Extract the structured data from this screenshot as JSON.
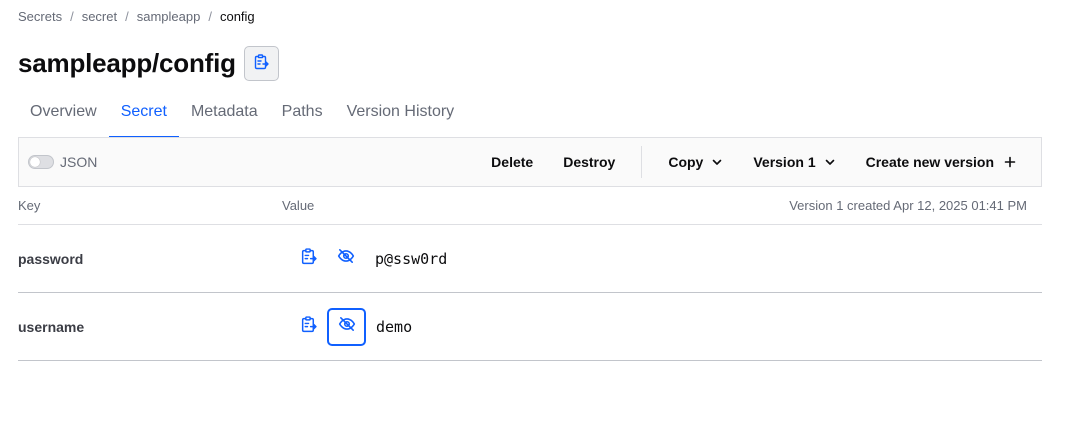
{
  "breadcrumb": {
    "items": [
      "Secrets",
      "secret",
      "sampleapp"
    ],
    "current": "config",
    "separator": "/"
  },
  "page": {
    "title": "sampleapp/config"
  },
  "tabs": [
    {
      "label": "Overview",
      "active": false
    },
    {
      "label": "Secret",
      "active": true
    },
    {
      "label": "Metadata",
      "active": false
    },
    {
      "label": "Paths",
      "active": false
    },
    {
      "label": "Version History",
      "active": false
    }
  ],
  "toolbar": {
    "json_label": "JSON",
    "json_enabled": false,
    "delete_label": "Delete",
    "destroy_label": "Destroy",
    "copy_label": "Copy",
    "version_label": "Version 1",
    "create_label": "Create new version"
  },
  "table": {
    "headers": {
      "key": "Key",
      "value": "Value"
    },
    "created_text": "Version 1 created Apr 12, 2025 01:41 PM",
    "rows": [
      {
        "key": "password",
        "value": "p@ssw0rd"
      },
      {
        "key": "username",
        "value": "demo"
      }
    ]
  },
  "icons": {
    "copy": "clipboard-copy-icon",
    "visibility": "eye-off-icon",
    "chevron": "chevron-down-icon",
    "plus": "plus-icon"
  },
  "colors": {
    "accent": "#1060ff",
    "text": "#0c0c0e",
    "muted": "#656a76",
    "border": "#dedfe3"
  }
}
